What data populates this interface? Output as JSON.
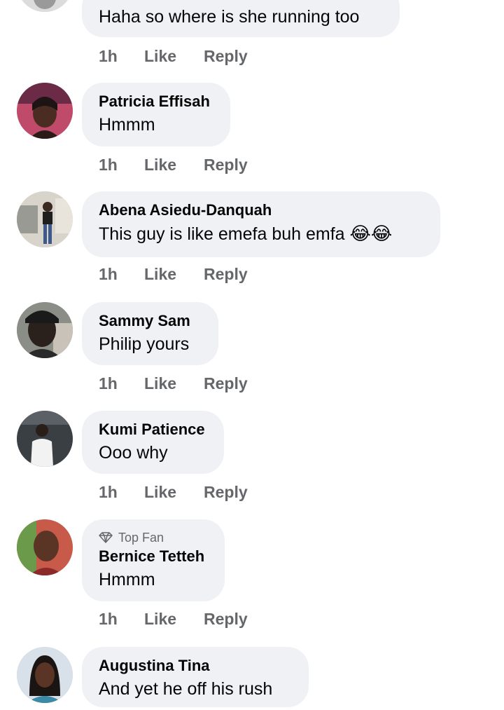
{
  "comments": [
    {
      "name": "",
      "text": "Haha so where is she running too",
      "time": "1h",
      "like": "Like",
      "reply": "Reply"
    },
    {
      "name": "Patricia Effisah",
      "text": "Hmmm",
      "time": "1h",
      "like": "Like",
      "reply": "Reply"
    },
    {
      "name": "Abena Asiedu-Danquah",
      "text": "This guy is like emefa buh emfa",
      "emoji": "😂😂",
      "time": "1h",
      "like": "Like",
      "reply": "Reply"
    },
    {
      "name": "Sammy Sam",
      "text": "Philip yours",
      "time": "1h",
      "like": "Like",
      "reply": "Reply"
    },
    {
      "name": "Kumi Patience",
      "text": "Ooo why",
      "time": "1h",
      "like": "Like",
      "reply": "Reply"
    },
    {
      "badge": "Top Fan",
      "name": "Bernice Tetteh",
      "text": "Hmmm",
      "time": "1h",
      "like": "Like",
      "reply": "Reply"
    },
    {
      "name": "Augustina Tina",
      "text": "And yet he off his rush"
    }
  ],
  "colors": {
    "bubble": "#eff1f5",
    "meta": "#65676b",
    "text": "#050505"
  }
}
